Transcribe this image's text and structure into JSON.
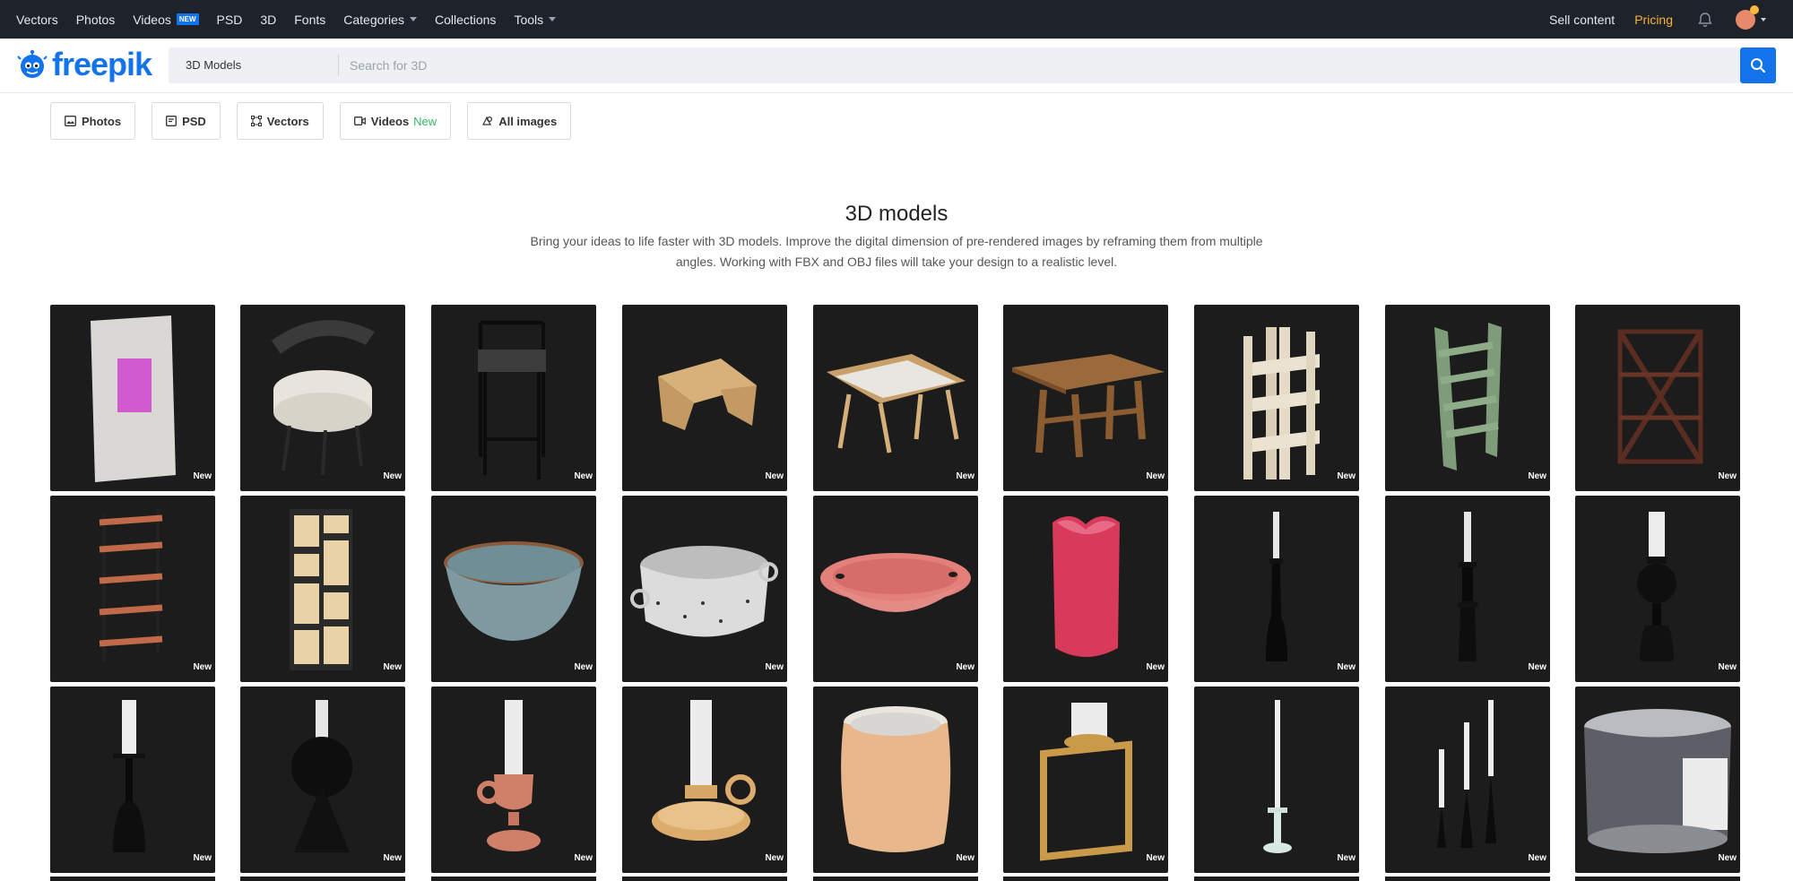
{
  "topnav": {
    "items": [
      {
        "label": "Vectors"
      },
      {
        "label": "Photos"
      },
      {
        "label": "Videos",
        "badge": "NEW"
      },
      {
        "label": "PSD"
      },
      {
        "label": "3D"
      },
      {
        "label": "Fonts"
      },
      {
        "label": "Categories",
        "dropdown": true
      },
      {
        "label": "Collections"
      },
      {
        "label": "Tools",
        "dropdown": true
      }
    ],
    "sell_content": "Sell content",
    "pricing": "Pricing"
  },
  "logo": {
    "text": "freepik"
  },
  "search": {
    "category": "3D Models",
    "placeholder": "Search for 3D"
  },
  "filters": [
    {
      "label": "Photos",
      "icon": "image-icon"
    },
    {
      "label": "PSD",
      "icon": "psd-icon"
    },
    {
      "label": "Vectors",
      "icon": "vector-icon"
    },
    {
      "label": "Videos",
      "icon": "video-icon",
      "extra": "New"
    },
    {
      "label": "All images",
      "icon": "all-images-icon"
    }
  ],
  "page": {
    "title": "3D models",
    "description": "Bring your ideas to life faster with 3D models. Improve the digital dimension of pre-rendered images by reframing them from multiple angles. Working with FBX and OBJ files will take your design to a realistic level."
  },
  "tiles": [
    {
      "subject": "canvas",
      "badge": "New"
    },
    {
      "subject": "chair",
      "badge": "New"
    },
    {
      "subject": "bar-stool",
      "badge": "New"
    },
    {
      "subject": "bed-tray",
      "badge": "New"
    },
    {
      "subject": "folding-tray",
      "badge": "New"
    },
    {
      "subject": "wood-bench",
      "badge": "New"
    },
    {
      "subject": "white-shelf",
      "badge": "New"
    },
    {
      "subject": "green-ladder-shelf",
      "badge": "New"
    },
    {
      "subject": "x-shelf",
      "badge": "New"
    },
    {
      "subject": "tall-bookcase",
      "badge": "New"
    },
    {
      "subject": "cube-bookcase",
      "badge": "New"
    },
    {
      "subject": "blue-bowl",
      "badge": "New"
    },
    {
      "subject": "terrazzo-pot",
      "badge": "New"
    },
    {
      "subject": "pink-dish",
      "badge": "New"
    },
    {
      "subject": "heart-candle",
      "badge": "New"
    },
    {
      "subject": "tall-candle-holder",
      "badge": "New"
    },
    {
      "subject": "candle-holder",
      "badge": "New"
    },
    {
      "subject": "ball-candle-holder",
      "badge": "New"
    },
    {
      "subject": "bottle-candle-holder",
      "badge": "New"
    },
    {
      "subject": "cone-candle-holder",
      "badge": "New"
    },
    {
      "subject": "clay-candle-holder",
      "badge": "New"
    },
    {
      "subject": "chamberstick",
      "badge": "New"
    },
    {
      "subject": "jar-candle",
      "badge": "New"
    },
    {
      "subject": "frame-candle-holder",
      "badge": "New"
    },
    {
      "subject": "taper-candle-stand",
      "badge": "New"
    },
    {
      "subject": "triple-candle-set",
      "badge": "New"
    },
    {
      "subject": "glass-jar-candle",
      "badge": "New"
    }
  ]
}
